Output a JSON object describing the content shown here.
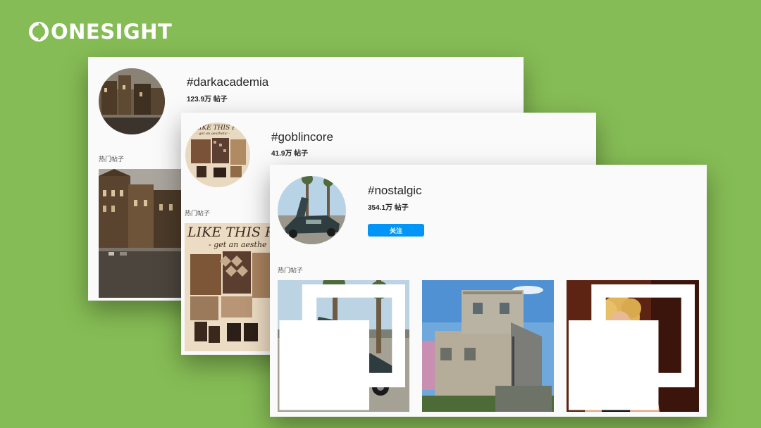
{
  "brand": {
    "name": "ONESIGHT",
    "color": "#ffffff",
    "background": "#86bc55"
  },
  "cards": [
    {
      "id": "darkacademia",
      "hashtag": "#darkacademia",
      "post_count": "123.9万 帖子",
      "section_label": "热门帖子"
    },
    {
      "id": "goblincore",
      "hashtag": "#goblincore",
      "post_count": "41.9万 帖子",
      "section_label": "热门帖子",
      "collage_text": {
        "avatar_line1": "LIKE THIS P",
        "avatar_line2": "- get an aesthetic -",
        "post_line1": "LIKE THIS P",
        "post_line2": "- get an aesthe"
      }
    },
    {
      "id": "nostalgic",
      "hashtag": "#nostalgic",
      "post_count": "354.1万 帖子",
      "follow_label": "关注",
      "section_label": "热门帖子"
    }
  ],
  "colors": {
    "card_bg": "#fafafa",
    "follow_button": "#0095f6",
    "text": "#262626"
  },
  "icons": [
    "onesight-logo-icon",
    "multi-post-icon"
  ]
}
